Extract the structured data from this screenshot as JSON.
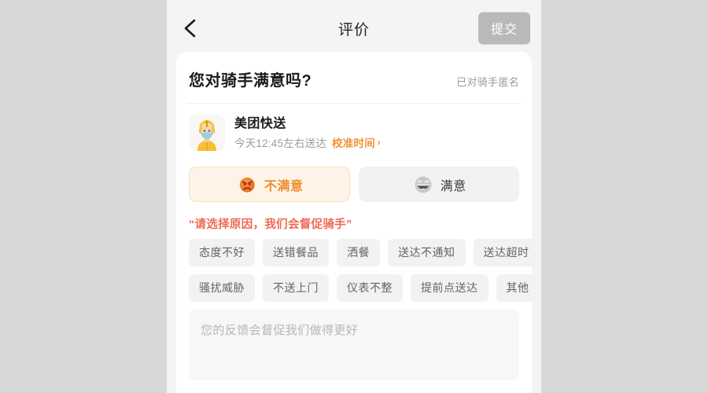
{
  "navbar": {
    "back_icon": "chevron-left-icon",
    "title": "评价",
    "submit_label": "提交",
    "submit_color": "#b9b9bc"
  },
  "card": {
    "title": "您对骑手满意吗?",
    "anonymous_note": "已对骑手匿名"
  },
  "rider": {
    "avatar_icon": "courier-avatar-icon",
    "name": "美团快送",
    "eta": "今天12:45左右送达",
    "calibrate_label": "校准时间",
    "calibrate_chevron": "›",
    "accent_color": "#f29236"
  },
  "ratings": {
    "selected": "dissatisfied",
    "options": [
      {
        "key": "dissatisfied",
        "label": "不满意",
        "icon": "angry-face-icon",
        "selected": true,
        "bg": "#fdf4e7",
        "text_color": "#ef8d2e"
      },
      {
        "key": "satisfied",
        "label": "满意",
        "icon": "smiling-face-icon",
        "selected": false,
        "bg": "#f2f2f2",
        "text_color": "#3b3b3b"
      }
    ]
  },
  "reason": {
    "hint": "“请选择原因，我们会督促骑手”",
    "hint_color": "#ef6a55",
    "rows": [
      [
        "态度不好",
        "送错餐品",
        "洒餐",
        "送达不通知",
        "送达超时"
      ],
      [
        "骚扰威胁",
        "不送上门",
        "仪表不整",
        "提前点送达",
        "其他"
      ]
    ]
  },
  "feedback": {
    "placeholder": "您的反馈会督促我们做得更好",
    "value": ""
  }
}
